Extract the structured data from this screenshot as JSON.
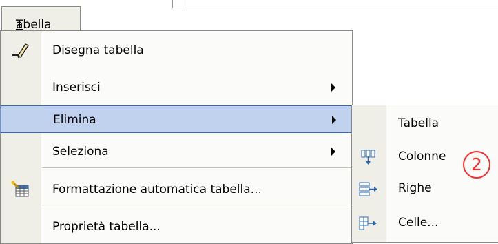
{
  "menu_bar": {
    "tab_label": "Tabella"
  },
  "menu": {
    "items": [
      {
        "label": "Disegna tabella",
        "icon": "pencil-icon",
        "submenu": false
      },
      {
        "label": "Inserisci",
        "icon": "",
        "submenu": true
      },
      {
        "label": "Elimina",
        "icon": "",
        "submenu": true,
        "highlighted": true
      },
      {
        "label": "Seleziona",
        "icon": "",
        "submenu": true
      },
      {
        "label": "Formattazione automatica tabella...",
        "icon": "table-autoformat-icon",
        "submenu": false
      },
      {
        "label": "Proprietà tabella...",
        "icon": "",
        "submenu": false
      }
    ]
  },
  "submenu": {
    "parent": "Elimina",
    "items": [
      {
        "label": "Tabella",
        "icon": ""
      },
      {
        "label": "Colonne",
        "icon": "delete-columns-icon"
      },
      {
        "label": "Righe",
        "icon": "delete-rows-icon"
      },
      {
        "label": "Celle...",
        "icon": "delete-cells-icon"
      }
    ]
  },
  "annotation": {
    "number": "2",
    "color": "#ff2a2a"
  },
  "colors": {
    "highlight_fill": "#c1d2ee",
    "highlight_border": "#316ac5",
    "menu_strip": "#efeee7",
    "menu_bg": "#fbfbf9"
  }
}
